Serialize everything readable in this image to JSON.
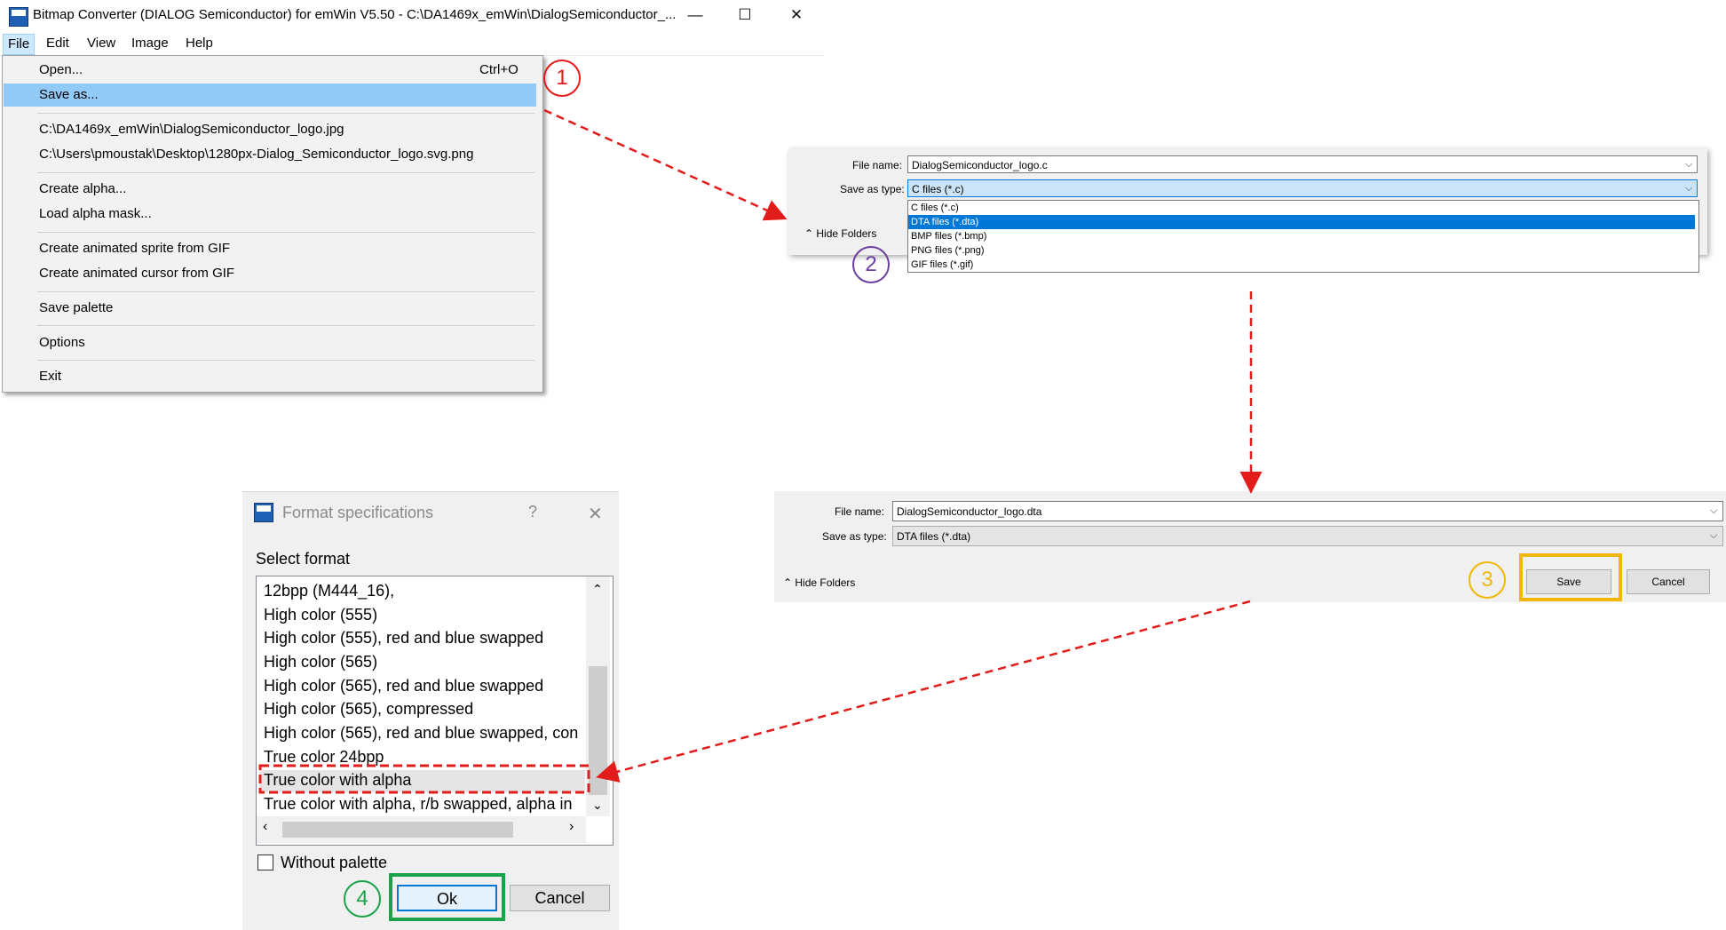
{
  "main_window": {
    "title": "Bitmap Converter (DIALOG Semiconductor) for emWin V5.50 - C:\\DA1469x_emWin\\DialogSemiconductor_...",
    "controls": {
      "minimize": "—",
      "maximize": "☐",
      "close": "✕"
    },
    "menu": [
      "File",
      "Edit",
      "View",
      "Image",
      "Help"
    ],
    "file_menu": {
      "open": "Open...",
      "open_shortcut": "Ctrl+O",
      "save_as": "Save as...",
      "recent_1": "C:\\DA1469x_emWin\\DialogSemiconductor_logo.jpg",
      "recent_2": "C:\\Users\\pmoustak\\Desktop\\1280px-Dialog_Semiconductor_logo.svg.png",
      "create_alpha": "Create alpha...",
      "load_alpha_mask": "Load alpha mask...",
      "create_sprite": "Create animated sprite from GIF",
      "create_cursor": "Create animated cursor from GIF",
      "save_palette": "Save palette",
      "options": "Options",
      "exit": "Exit"
    }
  },
  "steps": [
    "1",
    "2",
    "3",
    "4"
  ],
  "step_colors": [
    "#e21b1b",
    "#6b3fa0",
    "#f2b705",
    "#1aa34a"
  ],
  "save_dialog_1": {
    "file_name_label": "File name:",
    "file_name": "DialogSemiconductor_logo.c",
    "save_type_label": "Save as type:",
    "save_type": "C files (*.c)",
    "hide_folders": "Hide Folders",
    "type_options": [
      "C files (*.c)",
      "DTA files (*.dta)",
      "BMP files (*.bmp)",
      "PNG files (*.png)",
      "GIF files (*.gif)"
    ],
    "selected_option": "DTA files (*.dta)"
  },
  "save_dialog_2": {
    "file_name_label": "File name:",
    "file_name": "DialogSemiconductor_logo.dta",
    "save_type_label": "Save as type:",
    "save_type": "DTA files (*.dta)",
    "hide_folders": "Hide Folders",
    "save": "Save",
    "cancel": "Cancel"
  },
  "format_dialog": {
    "title": "Format specifications",
    "help": "?",
    "close": "✕",
    "select_format": "Select format",
    "formats": [
      "12bpp (M444_16),",
      "High color (555)",
      "High color (555), red and blue swapped",
      "High color (565)",
      "High color (565), red and blue swapped",
      "High color (565), compressed",
      "High color (565), red and blue swapped, con",
      "True color 24bpp",
      "True color with alpha",
      "True color with alpha, r/b swapped, alpha in"
    ],
    "selected_format": "True color with alpha",
    "without_palette": "Without palette",
    "ok": "Ok",
    "cancel": "Cancel"
  }
}
